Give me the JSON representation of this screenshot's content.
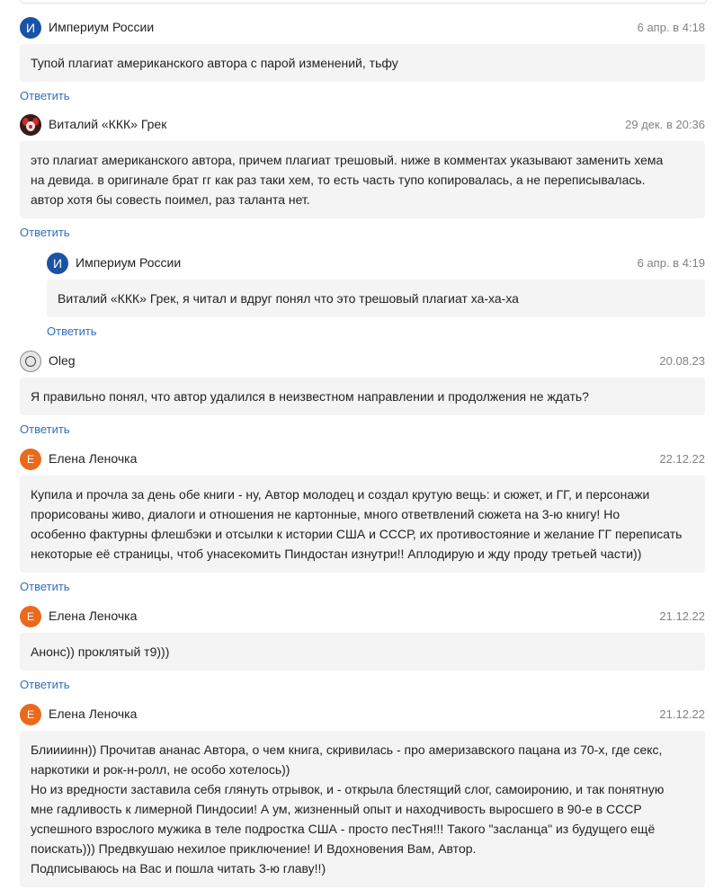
{
  "reply_label": "Ответить",
  "comments": [
    {
      "author": "Империум России",
      "avatar_letter": "И",
      "date": "6 апр. в 4:18",
      "lines": [
        "Тупой плагиат американского автора с парой изменений, тьфу"
      ]
    },
    {
      "author": "Виталий «ККК» Грек",
      "avatar_icon": "clown-avatar",
      "date": "29 дек. в 20:36",
      "lines": [
        "это плагиат американского автора, причем плагиат трешовый. ниже в комментах указывают заменить хема",
        "на девида. в оригинале брат гг как раз таки хем, то есть часть тупо копировалась, а не переписывалась.",
        "автор хотя бы совесть поимел, раз таланта нет."
      ]
    },
    {
      "author": "Империум России",
      "avatar_letter": "И",
      "date": "6 апр. в 4:19",
      "lines": [
        "Виталий «ККК» Грек, я читал и вдруг понял что это трешовый плагиат ха-ха-ха"
      ]
    },
    {
      "author": "Oleg",
      "avatar_icon": "circle-avatar",
      "date": "20.08.23",
      "lines": [
        "Я правильно понял, что автор удалился в неизвестном направлении и продолжения не ждать?"
      ]
    },
    {
      "author": "Елена Леночка",
      "avatar_letter": "Е",
      "date": "22.12.22",
      "lines": [
        "Купила и прочла за день обе книги - ну, Автор молодец и создал крутую вещь: и сюжет, и ГГ, и персонажи",
        "прорисованы живо, диалоги и отношения не картонные, много ответвлений сюжета на 3-ю книгу! Но",
        "особенно фактурны флешбэки и отсылки к истории США и СССР, их противостояние и желание ГГ переписать",
        "некоторые её страницы, чтоб унасекомить Пиндостан изнутри!! Аплодирую и жду проду третьей части))"
      ]
    },
    {
      "author": "Елена Леночка",
      "avatar_letter": "Е",
      "date": "21.12.22",
      "lines": [
        "Анонс)) проклятый т9)))"
      ]
    },
    {
      "author": "Елена Леночка",
      "avatar_letter": "Е",
      "date": "21.12.22",
      "lines": [
        "Блиииинн)) Прочитав ананас Автора, о чем книга, скривилась - про америзавского пацана из 70-х, где секс,",
        "наркотики и рок-н-ролл, не особо хотелось))",
        "Но из вредности заставила себя глянуть отрывок, и - открыла блестящий слог, самоиронию, и так понятную",
        "мне гадливость к лимерной Пиндосии! А ум, жизненный опыт и находчивость выросшего в 90-е в СССР",
        "успешного взрослого мужика в теле подростка США - просто песТня!!! Такого \"засланца\" из будущего ещё",
        "поискать))) Предвкушаю нехилое приключение! И Вдохновения Вам, Автор.",
        "Подписываюсь на Вас и пошла читать 3-ю главу!!)"
      ]
    }
  ]
}
